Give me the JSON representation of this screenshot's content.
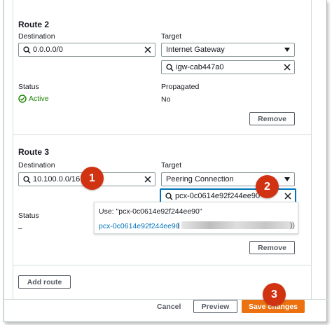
{
  "route2": {
    "title": "Route 2",
    "destination_label": "Destination",
    "destination_value": "0.0.0.0/0",
    "target_label": "Target",
    "target_select": "Internet Gateway",
    "target_value": "igw-cab447a0",
    "status_label": "Status",
    "status_value": "Active",
    "propagated_label": "Propagated",
    "propagated_value": "No",
    "remove_label": "Remove"
  },
  "route3": {
    "title": "Route 3",
    "destination_label": "Destination",
    "destination_value": "10.100.0.0/16",
    "target_label": "Target",
    "target_select": "Peering Connection",
    "target_value": "pcx-0c0614e92f244ee90",
    "status_label": "Status",
    "status_value": "–",
    "remove_label": "Remove"
  },
  "dropdown": {
    "use_text": "Use: \"pcx-0c0614e92f244ee90\"",
    "option_text": "pcx-0c0614e92f244ee90",
    "open_paren": "(",
    "close_paren": "))"
  },
  "footer": {
    "add_route": "Add route",
    "cancel": "Cancel",
    "preview": "Preview",
    "save": "Save changes"
  },
  "badges": [
    "1",
    "2",
    "3"
  ],
  "colors": {
    "accent_orange": "#ec7211",
    "link_blue": "#0073bb",
    "success_green": "#1d8102",
    "badge_red": "#d13212"
  }
}
